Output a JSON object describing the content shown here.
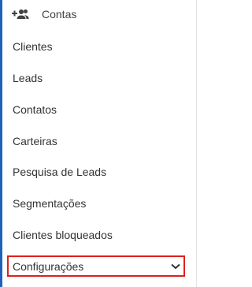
{
  "header": {
    "icon": "add-group-icon",
    "label": "Contas"
  },
  "menu": {
    "items": [
      {
        "label": "Clientes"
      },
      {
        "label": "Leads"
      },
      {
        "label": "Contatos"
      },
      {
        "label": "Carteiras"
      },
      {
        "label": "Pesquisa de Leads"
      },
      {
        "label": "Segmentações"
      },
      {
        "label": "Clientes bloqueados"
      }
    ],
    "config": {
      "label": "Configurações",
      "icon": "chevron-down-icon",
      "highlight_color": "#e0201b"
    }
  },
  "colors": {
    "accent": "#1e63b8",
    "text": "#333333"
  }
}
